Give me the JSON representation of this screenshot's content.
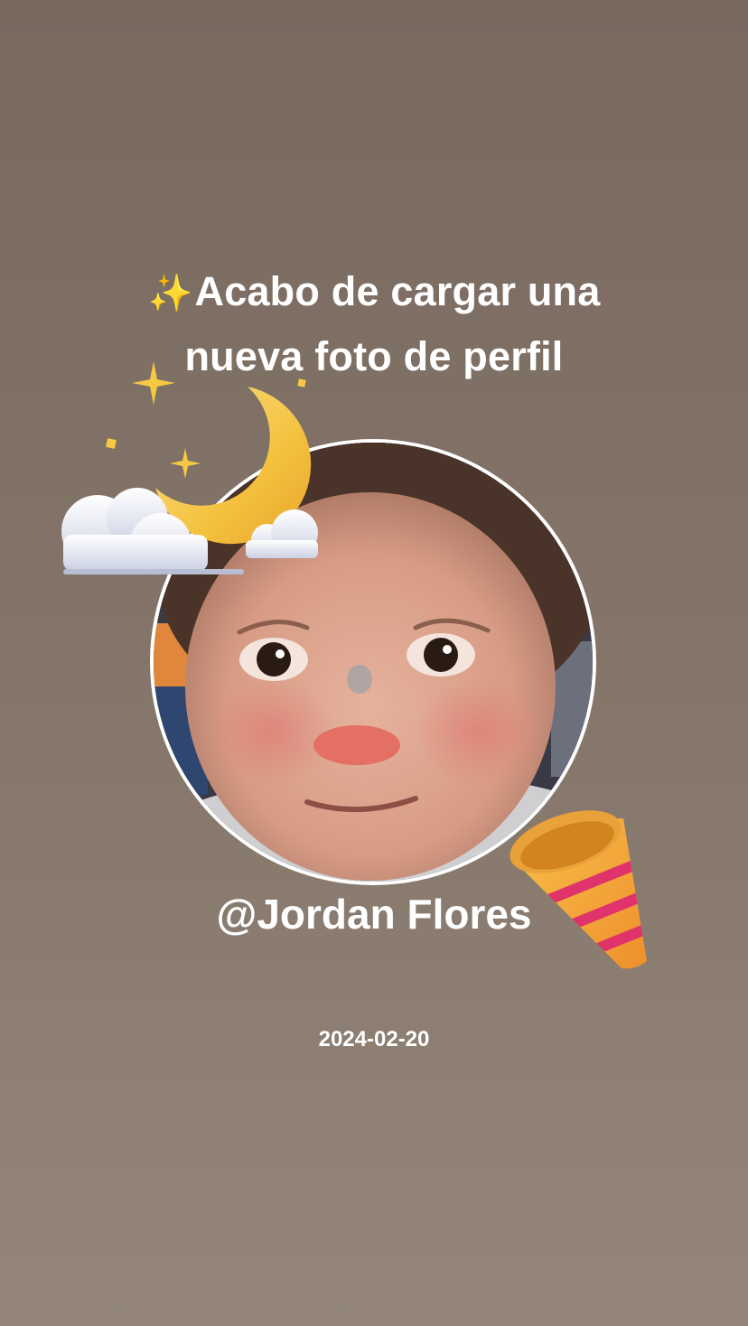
{
  "story": {
    "headline": {
      "line1": "Acabo de cargar una",
      "line2": "nueva foto de perfil",
      "leading_emoji": "sparkles"
    },
    "profile_photo": {
      "description": "new profile photo"
    },
    "stickers": {
      "moon": "crescent-moon-clouds-sticker",
      "party": "party-popper-sticker"
    },
    "username": "@Jordan Flores",
    "date": "2024-02-20"
  },
  "colors": {
    "background_top": "#786a5f",
    "background_bottom": "#938679",
    "text": "#ffffff",
    "moon": "#f4c23f",
    "sparkle": "#f6c944",
    "cloud": "#e6e8f2",
    "party_cone": "#f3a531",
    "party_stripe": "#e0326b"
  }
}
